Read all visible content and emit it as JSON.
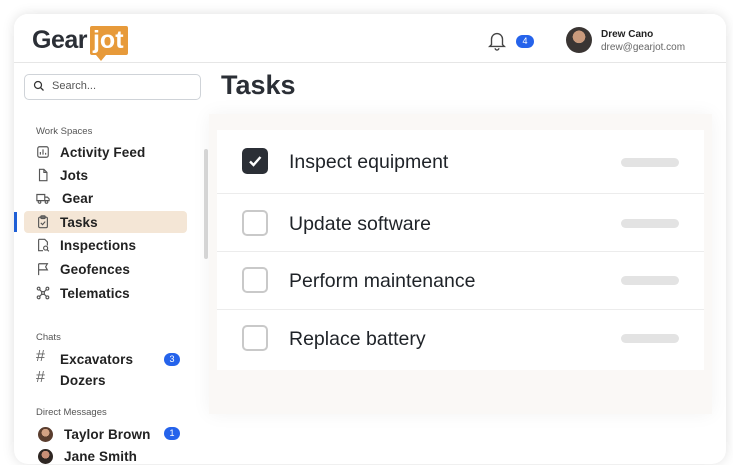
{
  "brand": {
    "part1": "Gear",
    "part2": "jot",
    "accent": "#e79a3a"
  },
  "header": {
    "notifications_count": "4",
    "user": {
      "name": "Drew Cano",
      "email": "drew@gearjot.com"
    }
  },
  "sidebar": {
    "search_placeholder": "Search...",
    "workspaces_label": "Work Spaces",
    "workspaces": [
      {
        "label": "Activity Feed",
        "icon": "activity-icon"
      },
      {
        "label": "Jots",
        "icon": "document-icon"
      },
      {
        "label": "Gear",
        "icon": "truck-icon"
      },
      {
        "label": "Tasks",
        "icon": "clipboard-icon",
        "active": true
      },
      {
        "label": "Inspections",
        "icon": "inspection-icon"
      },
      {
        "label": "Geofences",
        "icon": "flag-icon"
      },
      {
        "label": "Telematics",
        "icon": "network-icon"
      }
    ],
    "chats_label": "Chats",
    "chats": [
      {
        "label": "Excavators",
        "badge": "3"
      },
      {
        "label": "Dozers"
      }
    ],
    "dm_label": "Direct Messages",
    "direct_messages": [
      {
        "label": "Taylor Brown",
        "badge": "1"
      },
      {
        "label": "Jane Smith"
      }
    ]
  },
  "main": {
    "title": "Tasks",
    "tasks": [
      {
        "label": "Inspect equipment",
        "done": true
      },
      {
        "label": "Update software",
        "done": false
      },
      {
        "label": "Perform maintenance",
        "done": false
      },
      {
        "label": "Replace battery",
        "done": false
      }
    ]
  }
}
